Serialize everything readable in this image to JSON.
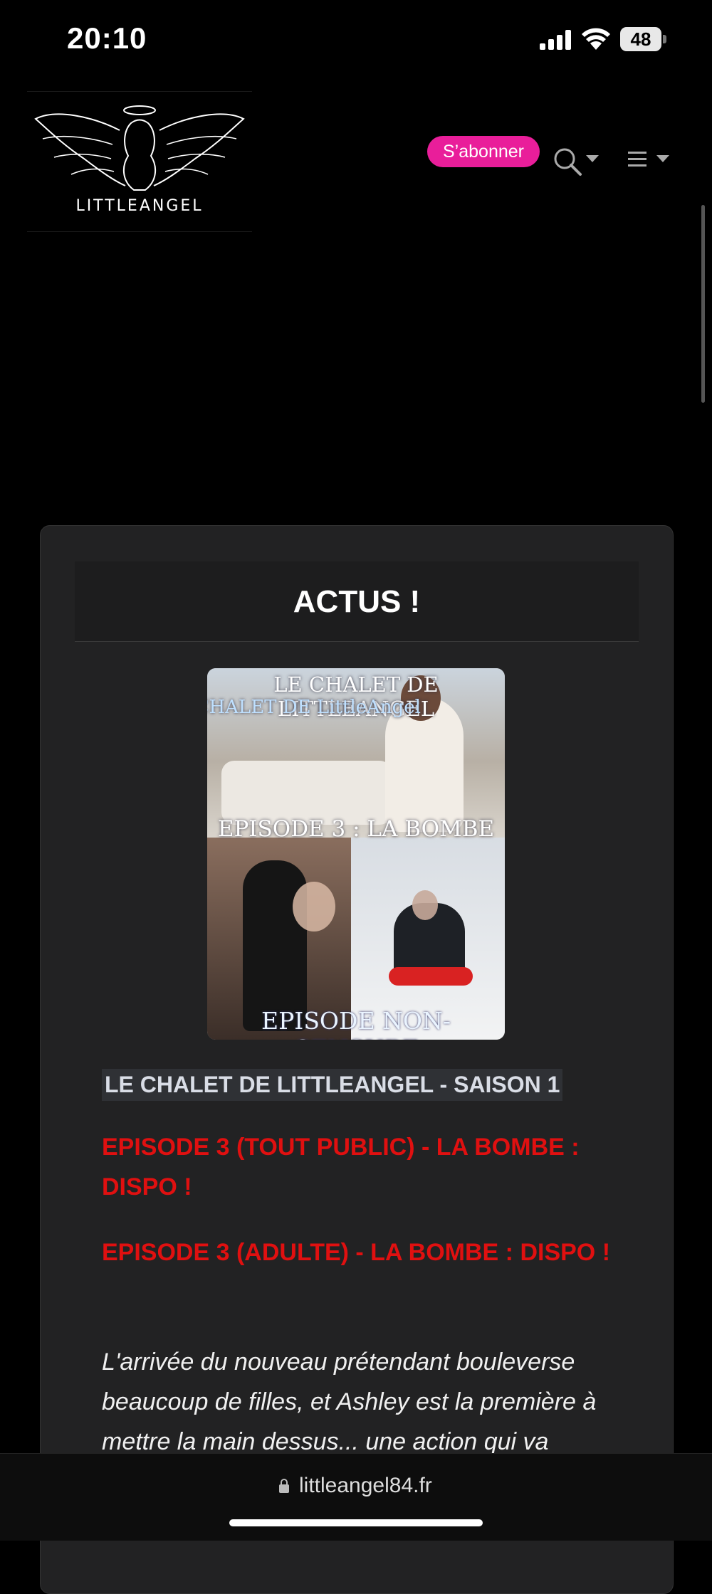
{
  "status_bar": {
    "time": "20:10",
    "battery": "48"
  },
  "header": {
    "logo_text": "LITTLEANGEL",
    "subscribe_label": "S’abonner",
    "icons": [
      "search-icon",
      "menu-icon"
    ]
  },
  "card": {
    "title": "ACTUS !",
    "poster": {
      "line1": "LE CHALET DE LITTLEANGEL",
      "line2": "LE CHALET DE LittleAngel",
      "line3": "EPISODE 3 : LA BOMBE",
      "line4": "EPISODE NON-CENSURE"
    },
    "series_title": "LE CHALET DE LITTLEANGEL - SAISON 1",
    "episode_public": "EPISODE 3 (TOUT PUBLIC) - LA BOMBE : DISPO !",
    "episode_adult": "EPISODE 3 (ADULTE) - LA BOMBE : DISPO !",
    "description": "L'arrivée du nouveau prétendant bouleverse beaucoup de filles, et Ashley est la première à mettre la main dessus... une action qui va"
  },
  "browser": {
    "url": "littleangel84.fr"
  },
  "colors": {
    "accent": "#e91e9a",
    "episode_red": "#e01010",
    "card_bg": "#222223"
  }
}
